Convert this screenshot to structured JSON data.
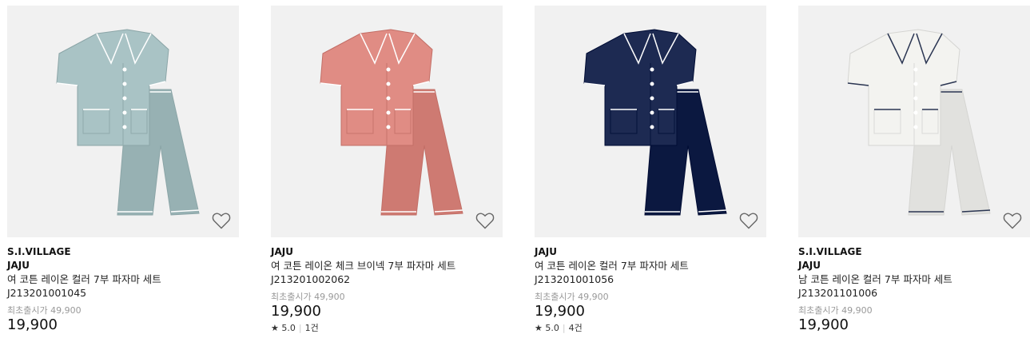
{
  "products": [
    {
      "brand_top": "S.I.VILLAGE",
      "brand": "JAJU",
      "name": "여 코튼 레이온 컬러 7부 파자마 세트",
      "code": "J213201001045",
      "original_price": "최초출시가 49,900",
      "price": "19,900",
      "rating": "",
      "reviews": "",
      "color": "#a9c3c5",
      "piping": "#ffffff",
      "icon": "heart-outline-icon"
    },
    {
      "brand_top": "",
      "brand": "JAJU",
      "name": "여 코튼 레이온 체크 브이넥 7부 파자마 세트",
      "code": "J213201002062",
      "original_price": "최초출시가 49,900",
      "price": "19,900",
      "rating": "★ 5.0",
      "reviews": "1건",
      "color": "#e08c84",
      "piping": "#ffffff",
      "icon": "heart-outline-icon"
    },
    {
      "brand_top": "",
      "brand": "JAJU",
      "name": "여 코튼 레이온 컬러 7부 파자마 세트",
      "code": "J213201001056",
      "original_price": "최초출시가 49,900",
      "price": "19,900",
      "rating": "★ 5.0",
      "reviews": "4건",
      "color": "#1d2a52",
      "piping": "#ffffff",
      "icon": "heart-outline-icon"
    },
    {
      "brand_top": "S.I.VILLAGE",
      "brand": "JAJU",
      "name": "남 코튼 레이온 컬러 7부 파자마 세트",
      "code": "J213201101006",
      "original_price": "최초출시가 49,900",
      "price": "19,900",
      "rating": "",
      "reviews": "",
      "color": "#f3f3f0",
      "piping": "#2a3552",
      "icon": "heart-outline-icon"
    }
  ]
}
